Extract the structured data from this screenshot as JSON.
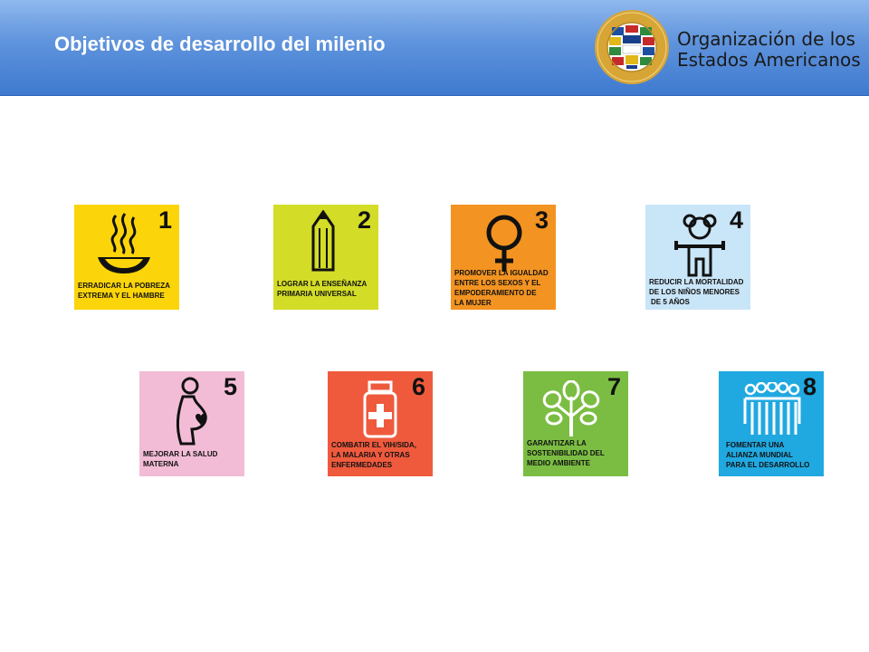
{
  "header": {
    "title": "Objetivos de desarrollo del milenio",
    "org_line1": "Organización de los",
    "org_line2": "Estados Americanos",
    "seal_text": "ORGANIZACIÓN DE LOS ESTADOS AMERICANOS",
    "colors": {
      "bar": "#5e93dc",
      "title": "#ffffff"
    }
  },
  "goals": [
    {
      "number": "1",
      "lines": [
        "ERRADICAR LA POBREZA",
        "EXTREMA Y EL HAMBRE"
      ],
      "color": "#fbd40a",
      "icon": "soup-bowl-icon"
    },
    {
      "number": "2",
      "lines": [
        "LOGRAR LA ENSEÑANZA",
        "PRIMARIA UNIVERSAL"
      ],
      "color": "#d3dc27",
      "icon": "pencil-icon"
    },
    {
      "number": "3",
      "lines": [
        "PROMOVER LA IGUALDAD",
        "ENTRE LOS SEXOS Y EL",
        "EMPODERAMIENTO DE",
        "LA MUJER"
      ],
      "color": "#f39321",
      "icon": "female-symbol-icon"
    },
    {
      "number": "4",
      "lines": [
        "REDUCIR LA MORTALIDAD",
        "DE LOS NIÑOS MENORES",
        "DE 5 AÑOS"
      ],
      "color": "#c9e5f8",
      "icon": "child-icon"
    },
    {
      "number": "5",
      "lines": [
        "MEJORAR LA SALUD",
        "MATERNA"
      ],
      "color": "#f3bcd6",
      "icon": "pregnant-woman-icon"
    },
    {
      "number": "6",
      "lines": [
        "COMBATIR EL VIH/SIDA,",
        "LA MALARIA Y OTRAS",
        "ENFERMEDADES"
      ],
      "color": "#ef5a3d",
      "icon": "medicine-bottle-icon"
    },
    {
      "number": "7",
      "lines": [
        "GARANTIZAR LA",
        "SOSTENIBILIDAD DEL",
        "MEDIO AMBIENTE"
      ],
      "color": "#7bbd42",
      "icon": "tree-icon"
    },
    {
      "number": "8",
      "lines": [
        "FOMENTAR UNA",
        "ALIANZA MUNDIAL",
        "PARA EL DESARROLLO"
      ],
      "color": "#20a8e0",
      "icon": "people-group-icon"
    }
  ]
}
